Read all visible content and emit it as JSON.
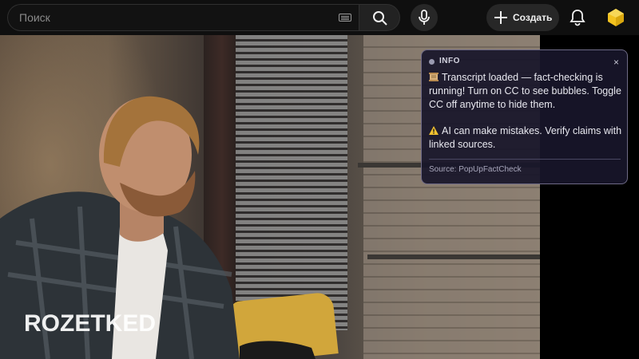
{
  "header": {
    "search": {
      "placeholder": "Поиск",
      "value": ""
    },
    "create_label": "Создать",
    "icons": {
      "keyboard": "keyboard-icon",
      "search": "search-icon",
      "mic": "mic-icon",
      "create": "plus-icon",
      "notifications": "bell-icon",
      "avatar": "channel-avatar"
    }
  },
  "video": {
    "watermark": "ROZETKED"
  },
  "info_popup": {
    "label": "INFO",
    "close": "×",
    "message_1": "Transcript loaded — fact-checking is running! Turn on CC to see bubbles. Toggle CC off anytime to hide them.",
    "message_2": "AI can make mistakes. Verify claims with linked sources.",
    "source": "Source: PopUpFactCheck",
    "icons": {
      "message_1": "scroll-icon",
      "message_2": "warning-icon"
    }
  },
  "colors": {
    "background": "#0f0f0f",
    "popup_bg": "#18162a",
    "popup_border": "#6e6a86",
    "avatar_yellow": "#f3c21f"
  }
}
